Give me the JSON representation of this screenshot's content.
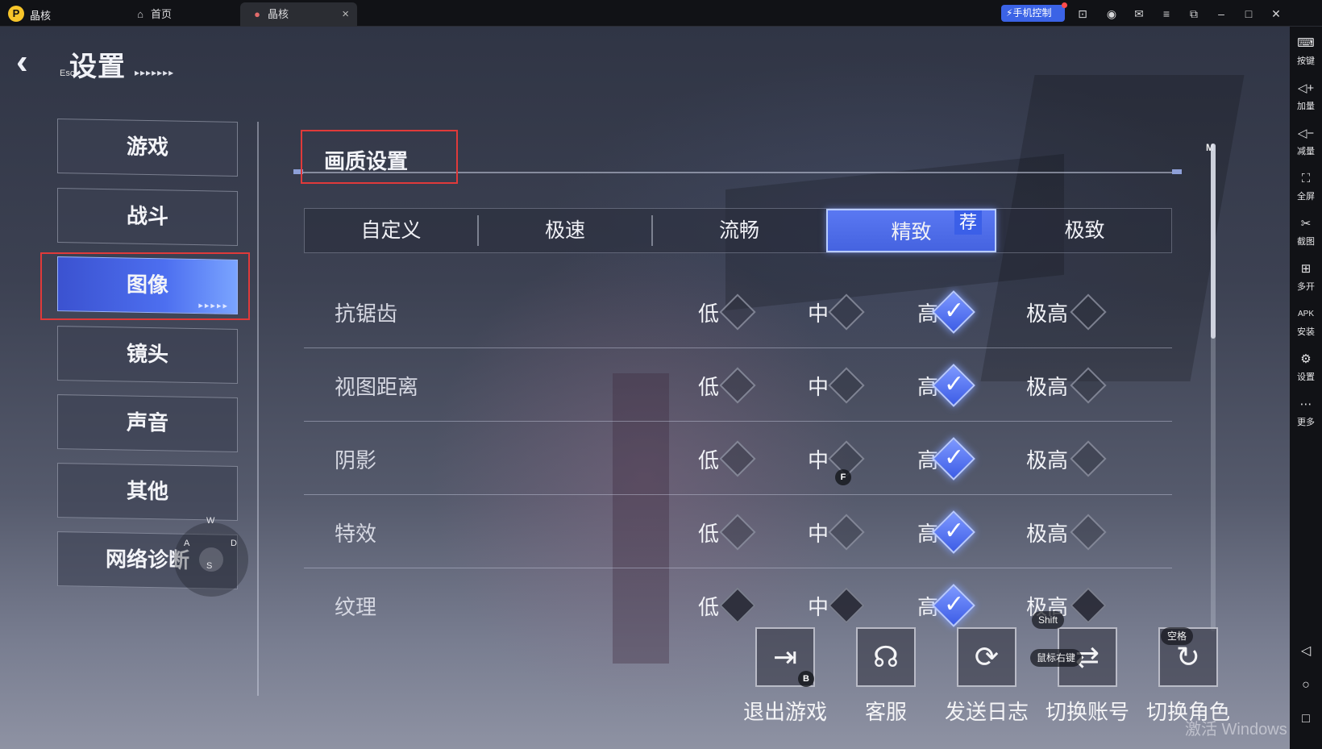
{
  "titlebar": {
    "app_name": "晶核",
    "tabs": [
      {
        "label": "首页",
        "icon": "home-icon"
      },
      {
        "label": "晶核",
        "icon": "game-avatar-icon",
        "close": "×"
      }
    ],
    "phone_control": "手机控制",
    "logo_glyph": "P"
  },
  "sidebar": {
    "items": [
      {
        "label": "按键",
        "icon": "keyboard-icon"
      },
      {
        "label": "加量",
        "icon": "volume-up-icon"
      },
      {
        "label": "减量",
        "icon": "volume-down-icon"
      },
      {
        "label": "全屏",
        "icon": "fullscreen-icon"
      },
      {
        "label": "截图",
        "icon": "scissors-icon"
      },
      {
        "label": "多开",
        "icon": "multi-instance-icon"
      },
      {
        "label": "安装",
        "icon": "apk-icon"
      },
      {
        "label": "设置",
        "icon": "gear-icon"
      },
      {
        "label": "更多",
        "icon": "more-icon"
      }
    ]
  },
  "header": {
    "title": "设置",
    "esc_key": "Esc"
  },
  "menu": {
    "items": [
      "游戏",
      "战斗",
      "图像",
      "镜头",
      "声音",
      "其他",
      "网络诊断"
    ],
    "active_index": 2
  },
  "joystick": {
    "w": "W",
    "a": "A",
    "s": "S",
    "d": "D"
  },
  "section": {
    "title": "画质设置",
    "hotkey": "M"
  },
  "presets": {
    "items": [
      "自定义",
      "极速",
      "流畅",
      "精致",
      "极致"
    ],
    "selected_index": 3,
    "recommend_badge": "荐"
  },
  "options": [
    "低",
    "中",
    "高",
    "极高"
  ],
  "settings": [
    {
      "label": "抗锯齿",
      "selected": "高"
    },
    {
      "label": "视图距离",
      "selected": "高"
    },
    {
      "label": "阴影",
      "selected": "高"
    },
    {
      "label": "特效",
      "selected": "高"
    },
    {
      "label": "纹理",
      "selected": "高"
    }
  ],
  "overlay_keys": {
    "f_key": "F",
    "b_key": "B",
    "shift_key": "Shift",
    "right_mouse": "鼠标右键",
    "space_key": "空格"
  },
  "actions": [
    {
      "label": "退出游戏",
      "icon": "exit-door-icon"
    },
    {
      "label": "客服",
      "icon": "headset-icon"
    },
    {
      "label": "发送日志",
      "icon": "send-log-icon"
    },
    {
      "label": "切换账号",
      "icon": "switch-account-icon"
    },
    {
      "label": "切换角色",
      "icon": "switch-character-icon"
    }
  ],
  "watermark": "激活 Windows",
  "colors": {
    "accent": "#4d6ff0",
    "highlight_box": "#e03a3a",
    "phone_control": "#3b63e6"
  }
}
